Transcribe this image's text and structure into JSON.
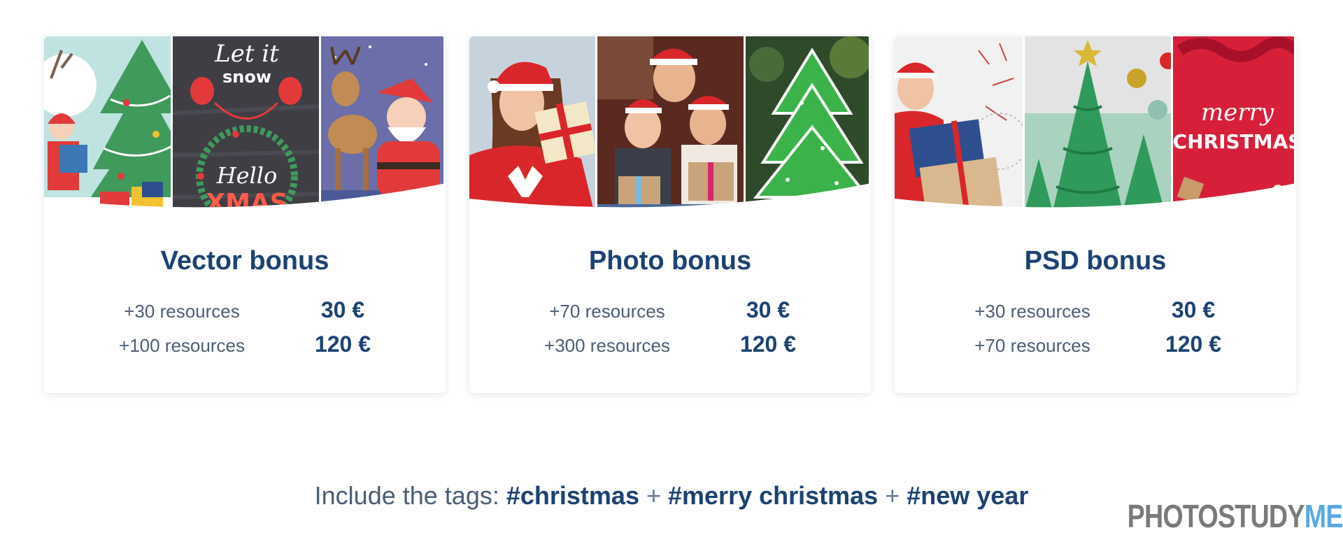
{
  "cards": [
    {
      "title": "Vector bonus",
      "rows": [
        {
          "resources": "+30 resources",
          "price": "30 €"
        },
        {
          "resources": "+100 resources",
          "price": "120 €"
        }
      ],
      "images": [
        "christmas-tree-santa-vector",
        "let-it-snow-hello-xmas-vector",
        "santa-reindeer-vector"
      ],
      "image_text": {
        "let_it": "Let it",
        "snow": "snow",
        "hello": "Hello",
        "xmas": "XMAS"
      }
    },
    {
      "title": "Photo bonus",
      "rows": [
        {
          "resources": "+70 resources",
          "price": "30 €"
        },
        {
          "resources": "+300 resources",
          "price": "120 €"
        }
      ],
      "images": [
        "woman-with-gift-photo",
        "family-in-santa-hats-photo",
        "gingerbread-tree-cookie-photo"
      ]
    },
    {
      "title": "PSD bonus",
      "rows": [
        {
          "resources": "+30 resources",
          "price": "30 €"
        },
        {
          "resources": "+70 resources",
          "price": "120 €"
        }
      ],
      "images": [
        "girl-with-presents-psd",
        "3d-christmas-tree-psd",
        "merry-christmas-red-psd"
      ],
      "image_text": {
        "merry": "merry",
        "christmas": "CHRISTMAS"
      }
    }
  ],
  "tags": {
    "prefix": "Include the tags:",
    "tag1": "#christmas",
    "tag2": "#merry christmas",
    "tag3": "#new year",
    "separator": "+"
  },
  "brand": {
    "part1": "PHOTOSTUDY",
    "part2": "ME",
    "color1": "#7a7a7a",
    "color2": "#5aa9e6"
  },
  "colors": {
    "title": "#1c4273",
    "text": "#4c5d75"
  }
}
